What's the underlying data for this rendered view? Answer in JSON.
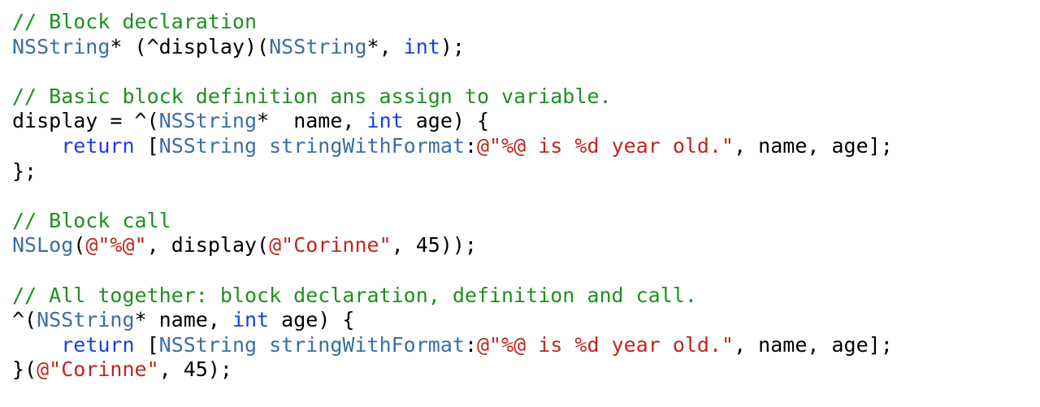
{
  "colors": {
    "background": "#ffffff",
    "plain": "#000000",
    "comment": "#1f8f1f",
    "type": "#3a6ea5",
    "keyword": "#1a3fe0",
    "string": "#c0271f"
  },
  "code": {
    "lines": [
      {
        "tokens": [
          {
            "t": "comment",
            "v": "// Block declaration"
          }
        ]
      },
      {
        "tokens": [
          {
            "t": "type",
            "v": "NSString"
          },
          {
            "t": "plain",
            "v": "* (^display)("
          },
          {
            "t": "type",
            "v": "NSString"
          },
          {
            "t": "plain",
            "v": "*, "
          },
          {
            "t": "keyword",
            "v": "int"
          },
          {
            "t": "plain",
            "v": ");"
          }
        ]
      },
      {
        "tokens": []
      },
      {
        "tokens": [
          {
            "t": "comment",
            "v": "// Basic block definition ans assign to variable."
          }
        ]
      },
      {
        "tokens": [
          {
            "t": "plain",
            "v": "display = ^("
          },
          {
            "t": "type",
            "v": "NSString"
          },
          {
            "t": "plain",
            "v": "*  name, "
          },
          {
            "t": "keyword",
            "v": "int"
          },
          {
            "t": "plain",
            "v": " age) {"
          }
        ]
      },
      {
        "tokens": [
          {
            "t": "plain",
            "v": "    "
          },
          {
            "t": "keyword",
            "v": "return"
          },
          {
            "t": "plain",
            "v": " ["
          },
          {
            "t": "type",
            "v": "NSString stringWithFormat"
          },
          {
            "t": "plain",
            "v": ":"
          },
          {
            "t": "string",
            "v": "@\"%@ is %d year old.\""
          },
          {
            "t": "plain",
            "v": ", name, age];"
          }
        ]
      },
      {
        "tokens": [
          {
            "t": "plain",
            "v": "};"
          }
        ]
      },
      {
        "tokens": []
      },
      {
        "tokens": [
          {
            "t": "comment",
            "v": "// Block call"
          }
        ]
      },
      {
        "tokens": [
          {
            "t": "type",
            "v": "NSLog"
          },
          {
            "t": "plain",
            "v": "("
          },
          {
            "t": "string",
            "v": "@\"%@\""
          },
          {
            "t": "plain",
            "v": ", display("
          },
          {
            "t": "string",
            "v": "@\"Corinne\""
          },
          {
            "t": "plain",
            "v": ", 45));"
          }
        ]
      },
      {
        "tokens": []
      },
      {
        "tokens": [
          {
            "t": "comment",
            "v": "// All together: block declaration, definition and call."
          }
        ]
      },
      {
        "tokens": [
          {
            "t": "plain",
            "v": "^("
          },
          {
            "t": "type",
            "v": "NSString"
          },
          {
            "t": "plain",
            "v": "* name, "
          },
          {
            "t": "keyword",
            "v": "int"
          },
          {
            "t": "plain",
            "v": " age) {"
          }
        ]
      },
      {
        "tokens": [
          {
            "t": "plain",
            "v": "    "
          },
          {
            "t": "keyword",
            "v": "return"
          },
          {
            "t": "plain",
            "v": " ["
          },
          {
            "t": "type",
            "v": "NSString stringWithFormat"
          },
          {
            "t": "plain",
            "v": ":"
          },
          {
            "t": "string",
            "v": "@\"%@ is %d year old.\""
          },
          {
            "t": "plain",
            "v": ", name, age];"
          }
        ]
      },
      {
        "tokens": [
          {
            "t": "plain",
            "v": "}("
          },
          {
            "t": "string",
            "v": "@\"Corinne\""
          },
          {
            "t": "plain",
            "v": ", 45);"
          }
        ]
      }
    ]
  }
}
